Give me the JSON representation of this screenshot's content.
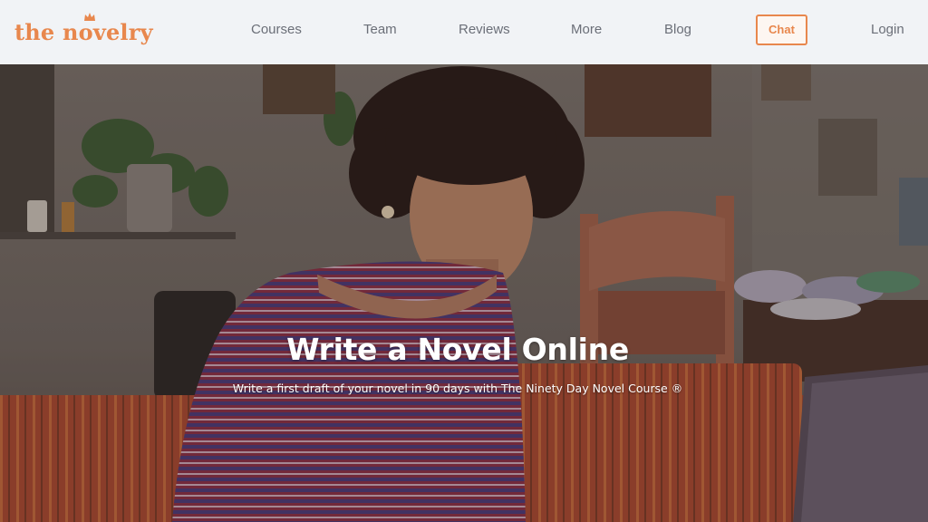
{
  "header": {
    "logo_text": "the novelry",
    "nav": [
      {
        "label": "Courses"
      },
      {
        "label": "Team"
      },
      {
        "label": "Reviews"
      },
      {
        "label": "More"
      },
      {
        "label": "Blog"
      }
    ],
    "chat_label": "Chat",
    "login_label": "Login"
  },
  "hero": {
    "title": "Write a Novel Online",
    "subtitle": "Write a first draft of your novel in 90 days with The Ninety Day Novel Course ®"
  },
  "colors": {
    "brand_orange": "#e8874d",
    "header_bg": "#f1f3f6",
    "nav_text": "#6b6f78"
  },
  "icons": {
    "logo_mark": "crown-icon"
  }
}
